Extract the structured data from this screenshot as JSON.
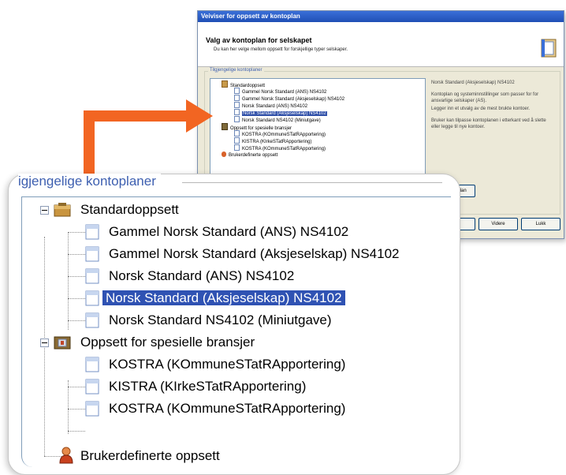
{
  "wizard": {
    "title": "Veiviser for oppsett av kontoplan",
    "header_title": "Valg av kontoplan for selskapet",
    "header_subtitle": "Du kan her velge mellom oppsett for forskjellige typer selskaper.",
    "group_label": "Tilgjengelige kontoplaner",
    "tree": [
      {
        "label": "Standardoppsett",
        "icon": "folder-icon"
      },
      {
        "label": "Gammel Norsk Standard (ANS) NS4102",
        "icon": "document-icon"
      },
      {
        "label": "Gammel Norsk Standard (Aksjeselskap) NS4102",
        "icon": "document-icon"
      },
      {
        "label": "Norsk Standard (ANS) NS4102",
        "icon": "document-icon"
      },
      {
        "label": "Norsk Standard (Aksjeselskap) NS4102",
        "icon": "document-icon",
        "selected": true
      },
      {
        "label": "Norsk Standard NS4102 (Miniutgave)",
        "icon": "document-icon"
      },
      {
        "label": "Oppsett for spesielle bransjer",
        "icon": "folder-icon"
      },
      {
        "label": "KOSTRA (KOmmuneSTatRApportering)",
        "icon": "document-icon"
      },
      {
        "label": "KISTRA (KIrkeSTatRApportering)",
        "icon": "document-icon"
      },
      {
        "label": "KOSTRA (KOmmuneSTatRApportering)",
        "icon": "document-icon"
      },
      {
        "label": "Brukerdefinerte oppsett",
        "icon": "user-icon"
      }
    ],
    "description": {
      "title": "Norsk Standard (Aksjeselskap) NS4102",
      "p1": "Kontoplan og systeminnstillinger som passer for for ansvarlige selskaper (AS).",
      "p2": "Legger inn et utvalg av de mest brukte kontoer.",
      "p3": "Bruker kan tilpasse kontoplanen i etterkant ved å slette eller legge til nye kontoer."
    },
    "buttons": {
      "kontoplan": "plan",
      "tilbake": "",
      "videre": "Videre",
      "lukk": "Lukk"
    }
  },
  "zoom": {
    "group_label": "igjengelige kontoplaner",
    "items": [
      {
        "label": "Standardoppsett"
      },
      {
        "label": "Gammel Norsk Standard  (ANS) NS4102"
      },
      {
        "label": "Gammel Norsk Standard  (Aksjeselskap) NS4102"
      },
      {
        "label": "Norsk Standard  (ANS) NS4102"
      },
      {
        "label": "Norsk Standard  (Aksjeselskap) NS4102",
        "selected": true
      },
      {
        "label": "Norsk Standard  NS4102 (Miniutgave)"
      },
      {
        "label": "Oppsett for spesielle bransjer"
      },
      {
        "label": "KOSTRA (KOmmuneSTatRApportering)"
      },
      {
        "label": "KISTRA (KIrkeSTatRApportering)"
      },
      {
        "label": "KOSTRA (KOmmuneSTatRApportering)"
      },
      {
        "label": "Brukerdefinerte oppsett"
      }
    ]
  },
  "colors": {
    "arrow": "#f26522",
    "selection": "#2f52b3",
    "group_label": "#3d5fb0"
  }
}
